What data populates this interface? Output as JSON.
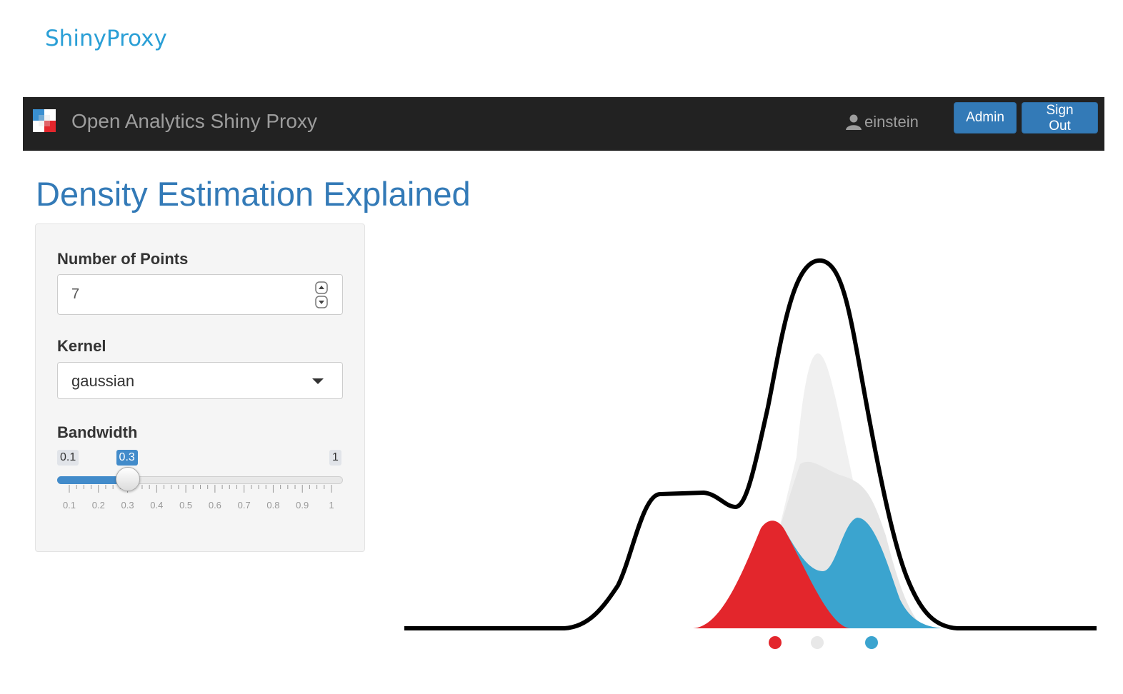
{
  "page": {
    "brand": "ShinyProxy"
  },
  "navbar": {
    "title": "Open Analytics Shiny Proxy",
    "user": "einstein",
    "admin_label": "Admin",
    "signout_label": "Sign Out"
  },
  "app": {
    "title": "Density Estimation Explained",
    "points": {
      "label": "Number of Points",
      "value": "7"
    },
    "kernel": {
      "label": "Kernel",
      "value": "gaussian"
    },
    "bandwidth": {
      "label": "Bandwidth",
      "min": 0.1,
      "max": 1,
      "value": 0.3,
      "min_label": "0.1",
      "max_label": "1",
      "value_label": "0.3",
      "ticks": [
        "0.1",
        "0.2",
        "0.3",
        "0.4",
        "0.5",
        "0.6",
        "0.7",
        "0.8",
        "0.9",
        "1"
      ]
    }
  },
  "colors": {
    "brand": "#2a9fd6",
    "primary": "#337ab7",
    "navbar": "#222222",
    "red": "#e3262c",
    "blue": "#3ba4cf",
    "grey": "#e6e6e6",
    "light_grey": "#f0f0f0"
  },
  "icons": {
    "user": "user-icon",
    "logo": "openanalytics-logo"
  }
}
